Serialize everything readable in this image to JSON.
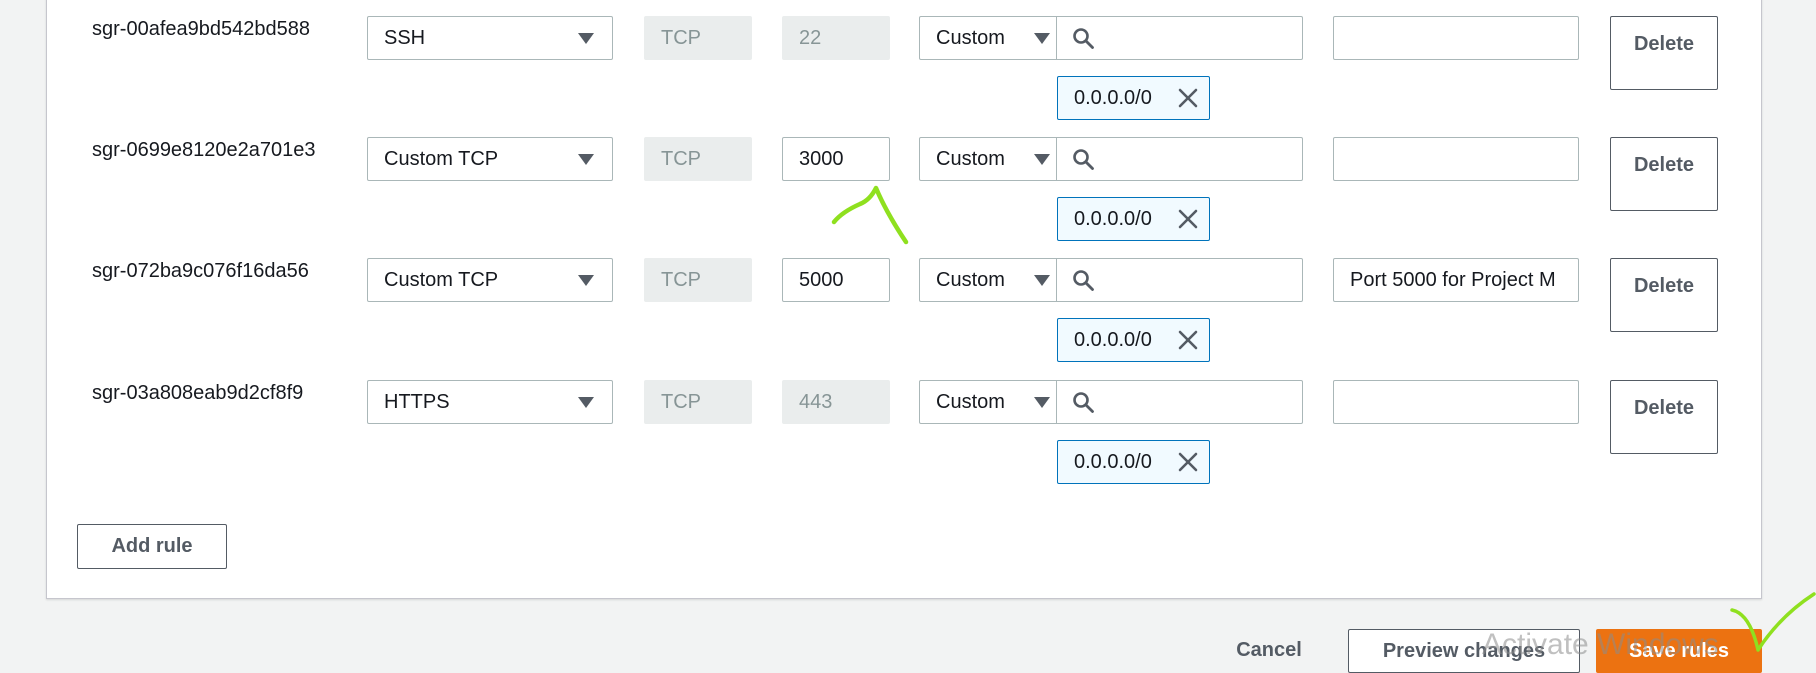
{
  "colors": {
    "primary_button": "#ec7211",
    "token_border": "#0073bb",
    "token_bg": "#f1faff",
    "annotation": "#8fe01f"
  },
  "rules": [
    {
      "id": "sgr-00afea9bd542bd588",
      "type": "SSH",
      "protocol": "TCP",
      "port_range": "22",
      "port_editable": false,
      "source_type": "Custom",
      "source_search_placeholder": "",
      "source_cidr": "0.0.0.0/0",
      "description": "",
      "delete_label": "Delete"
    },
    {
      "id": "sgr-0699e8120e2a701e3",
      "type": "Custom TCP",
      "protocol": "TCP",
      "port_range": "3000",
      "port_editable": true,
      "source_type": "Custom",
      "source_search_placeholder": "",
      "source_cidr": "0.0.0.0/0",
      "description": "",
      "delete_label": "Delete"
    },
    {
      "id": "sgr-072ba9c076f16da56",
      "type": "Custom TCP",
      "protocol": "TCP",
      "port_range": "5000",
      "port_editable": true,
      "source_type": "Custom",
      "source_search_placeholder": "",
      "source_cidr": "0.0.0.0/0",
      "description": "Port 5000 for Project M",
      "delete_label": "Delete"
    },
    {
      "id": "sgr-03a808eab9d2cf8f9",
      "type": "HTTPS",
      "protocol": "TCP",
      "port_range": "443",
      "port_editable": false,
      "source_type": "Custom",
      "source_search_placeholder": "",
      "source_cidr": "0.0.0.0/0",
      "description": "",
      "delete_label": "Delete"
    }
  ],
  "actions": {
    "add_rule": "Add rule",
    "cancel": "Cancel",
    "preview_changes": "Preview changes",
    "save_rules": "Save rules"
  },
  "watermark": "Activate Windows"
}
